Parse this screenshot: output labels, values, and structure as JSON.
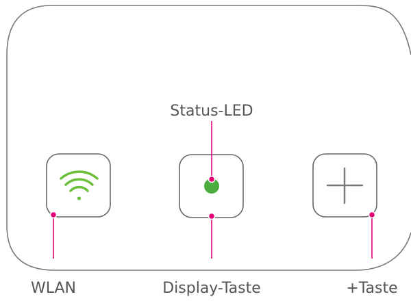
{
  "labels": {
    "status_led": "Status-LED",
    "wlan": "WLAN",
    "display_button": "Display-Taste",
    "plus_button": "+Taste"
  },
  "colors": {
    "device_outline": "#777777",
    "button_outline": "#666666",
    "callout": "#e20074",
    "wifi_icon": "#6bbf3b",
    "status_led": "#4aad3e",
    "plus_icon": "#777777",
    "text": "#555555"
  },
  "icons": {
    "wlan_button": "wifi-icon",
    "display_button": "status-led-dot",
    "plus_button": "plus-icon"
  }
}
